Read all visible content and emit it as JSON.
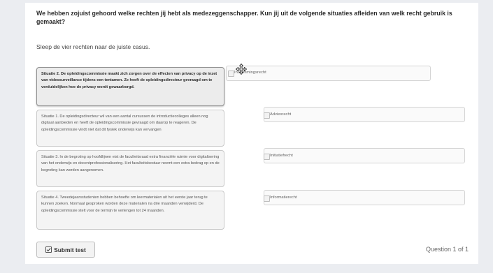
{
  "question": "We hebben zojuist gehoord welke rechten jij hebt als medezeggenschapper. Kun jij uit de volgende situaties afleiden van welk recht gebruik is gemaakt?",
  "instruction": "Sleep de vier rechten naar de juiste casus.",
  "situations": [
    {
      "text": "Situatie 2. De opleidingscommissie maakt zich zorgen over de effecten van privacy op de inzet van videosurveillance tijdens een tentamen. Ze heeft de opleidingsdirecteur gevraagd om te verduidelijken hoe de privacy wordt gewaarborgd."
    },
    {
      "text": "Situatie 1. De opleidingsdirecteur wil van een aantal cursussen de introductiecolleges alleen nog digitaal aanbieden en heeft de opleidingscommissie gevraagd om daarop te reageren. De opleidingscommissie vindt niet dat dit fysiek onderwijs kan vervangen"
    },
    {
      "text": "Situatie 3. In de begroting op hoofdlijnen eist de faculteitsraad extra financiële ruimte voor digitalisering van het onderwijs en docentprofessionalisering. Het faculteitsbestuur neemt een extra bedrag op en de begroting kan worden aangenomen."
    },
    {
      "text": "Situatie 4. Tweedejaarsstudenten hebben behoefte om leermaterialen uit het eerste jaar terug te kunnen zoeken. Normaal gesproken worden deze materialen na drie maanden verwijderd. De opleidingscommissie stelt voor de termijn te verlengen tot 24 maanden."
    }
  ],
  "rights": [
    {
      "label": "Instemmingsrecht"
    },
    {
      "label": "Adviesrecht"
    },
    {
      "label": "Initiatiefrecht"
    },
    {
      "label": "Informatierecht"
    }
  ],
  "submit_label": "Submit test",
  "progress": "Question 1 of 1",
  "icons": {
    "submit": "checkbox-icon",
    "drag": "move-cursor-icon"
  },
  "colors": {
    "background": "#ebedf1",
    "card": "#ffffff"
  }
}
